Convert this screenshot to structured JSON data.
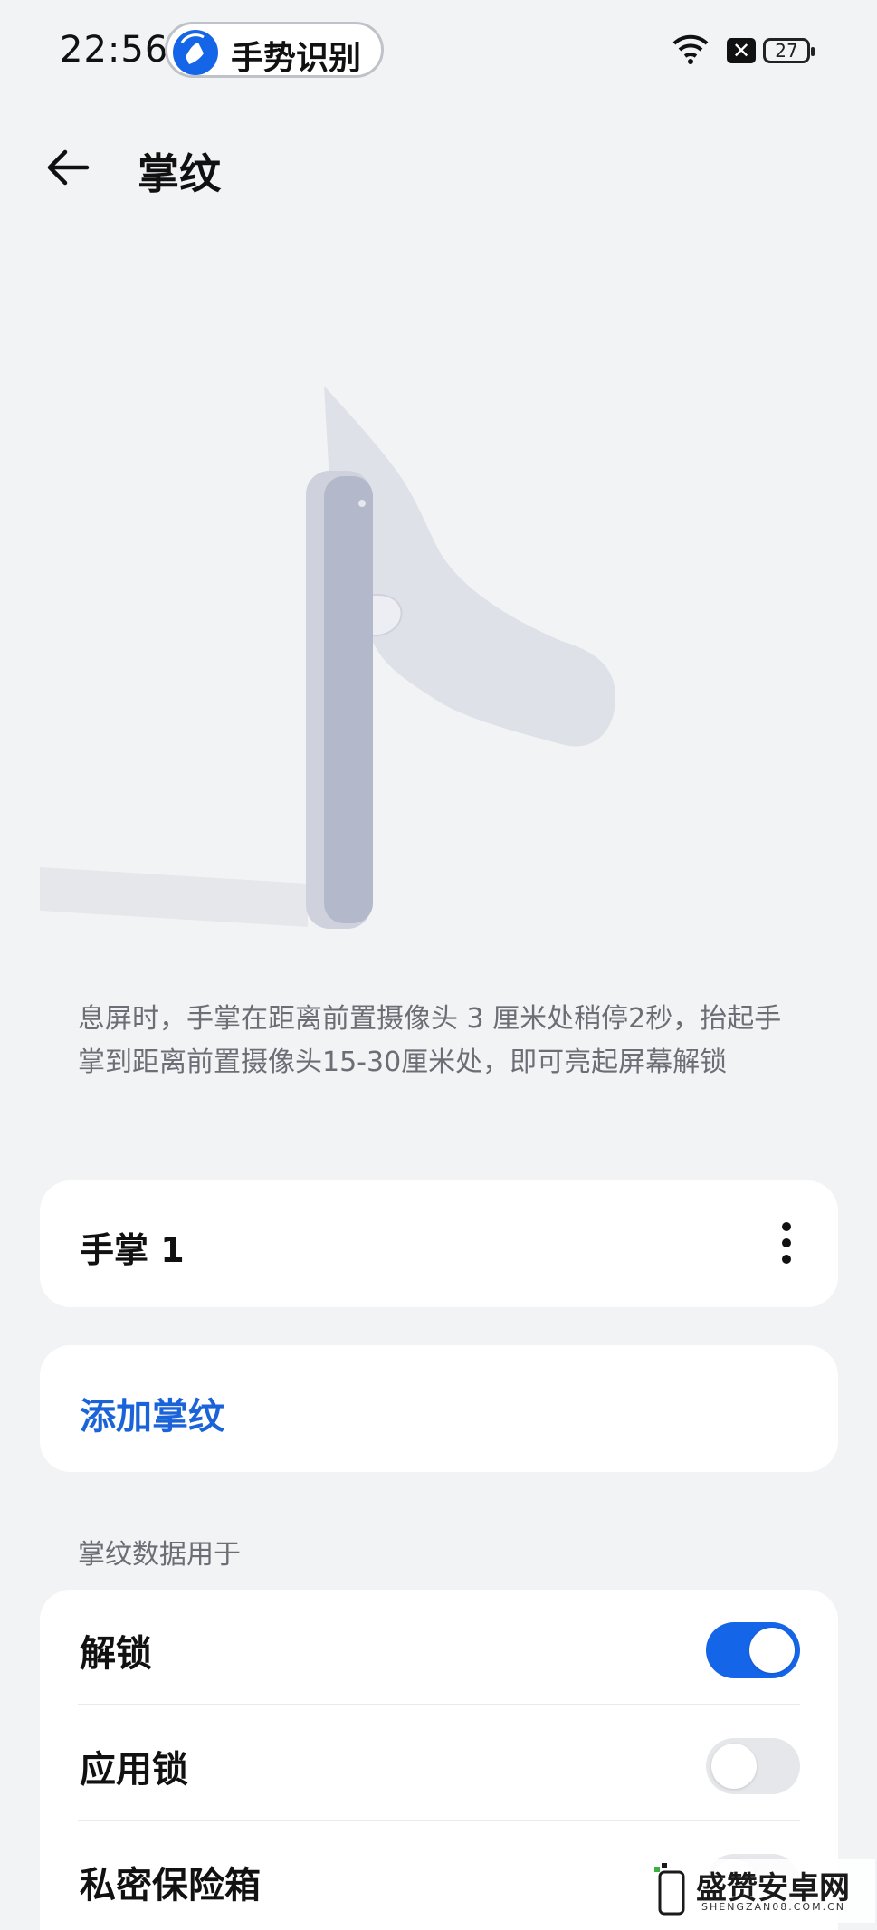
{
  "status_bar": {
    "time": "22:56",
    "gesture_pill_label": "手势识别",
    "battery_level": "27",
    "icons": [
      "wifi-icon",
      "sim-blocked-icon",
      "battery-icon"
    ]
  },
  "header": {
    "title": "掌纹",
    "back_icon": "back-arrow-icon"
  },
  "hint": "息屏时，手掌在距离前置摄像头 3 厘米处稍停2秒，抬起手掌到距离前置摄像头15-30厘米处，即可亮起屏幕解锁",
  "palm_entry": {
    "label": "手掌 1",
    "menu_icon": "more-vertical-icon"
  },
  "add_palm_label": "添加掌纹",
  "usage_section": {
    "label": "掌纹数据用于",
    "items": [
      {
        "label": "解锁",
        "on": true
      },
      {
        "label": "应用锁",
        "on": false
      },
      {
        "label": "私密保险箱",
        "on": false
      }
    ]
  },
  "colors": {
    "accent": "#1565e8",
    "link": "#1a63d8",
    "background": "#f2f3f5"
  },
  "watermark": {
    "text": "盛赞安卓网",
    "sub": "SHENGZAN08.COM.CN"
  }
}
